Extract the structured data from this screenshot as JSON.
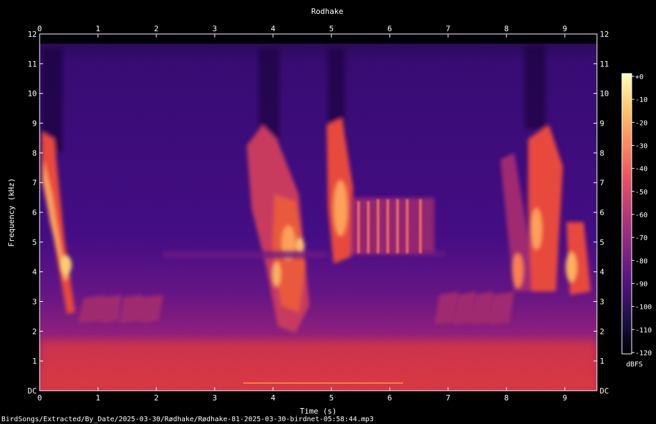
{
  "chart_data": {
    "type": "heatmap",
    "title": "Rodhake",
    "xlabel": "Time (s)",
    "ylabel": "Frequency (kHz)",
    "xlim": [
      0,
      9.55
    ],
    "ylim": [
      0,
      12
    ],
    "x_ticks": [
      "0",
      "1",
      "2",
      "3",
      "4",
      "5",
      "6",
      "7",
      "8",
      "9"
    ],
    "y_ticks": [
      "DC",
      "1",
      "2",
      "3",
      "4",
      "5",
      "6",
      "7",
      "8",
      "9",
      "10",
      "11",
      "12"
    ],
    "colorbar": {
      "label": "dBFS",
      "range": [
        -120,
        0
      ],
      "ticks": [
        "+0",
        "-10",
        "-20",
        "-30",
        "-40",
        "-50",
        "-60",
        "-70",
        "-80",
        "-90",
        "-100",
        "-110",
        "-120"
      ],
      "colormap": [
        "#000004",
        "#1d1147",
        "#51127c",
        "#832681",
        "#b73779",
        "#e75263",
        "#fc8961",
        "#fcc76e",
        "#fcfdbf"
      ]
    },
    "footer": "BirdSongs/Extracted/By_Date/2025-03-30/Rødhake/Rødhake-81-2025-03-30-birdnet-05:58:44.mp3"
  }
}
